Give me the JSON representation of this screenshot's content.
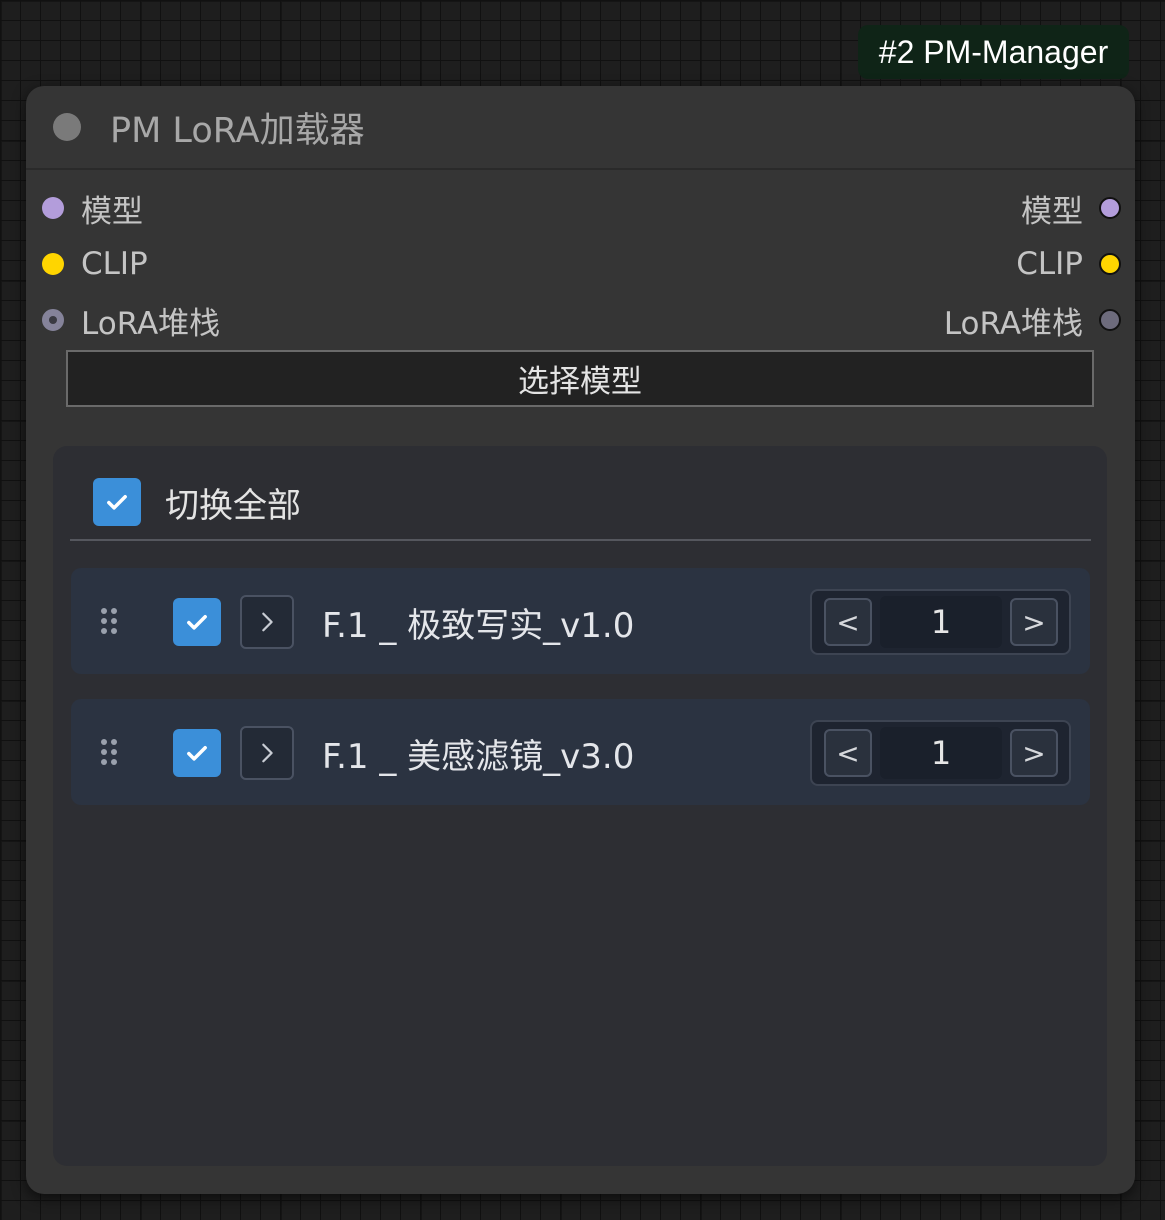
{
  "badge": {
    "label": "#2 PM-Manager"
  },
  "node": {
    "title": "PM LoRA加载器",
    "inputs": [
      {
        "label": "模型",
        "color": "#b39ddb"
      },
      {
        "label": "CLIP",
        "color": "#ffd500"
      },
      {
        "label": "LoRA堆栈",
        "color": "#6d6b7c"
      }
    ],
    "outputs": [
      {
        "label": "模型",
        "color": "#b39ddb"
      },
      {
        "label": "CLIP",
        "color": "#ffd500"
      },
      {
        "label": "LoRA堆栈",
        "color": "#6d6b7c"
      }
    ],
    "select_button": "选择模型"
  },
  "panel": {
    "toggle_all": {
      "label": "切换全部",
      "checked": true
    },
    "loras": [
      {
        "name": "F.1 _ 极致写实_v1.0",
        "enabled": true,
        "strength": "1",
        "dec": "<",
        "inc": ">"
      },
      {
        "name": "F.1 _ 美感滤镜_v3.0",
        "enabled": true,
        "strength": "1",
        "dec": "<",
        "inc": ">"
      }
    ]
  },
  "colors": {
    "accent": "#3b8fd9",
    "badge_bg": "#0f2417",
    "node_bg": "#353535",
    "panel_bg": "#2d2e33",
    "item_bg": "#2b3341"
  },
  "icons": {
    "checkbox": "check-icon",
    "expand": "chevron-right-icon",
    "drag": "drag-handle-icon"
  }
}
